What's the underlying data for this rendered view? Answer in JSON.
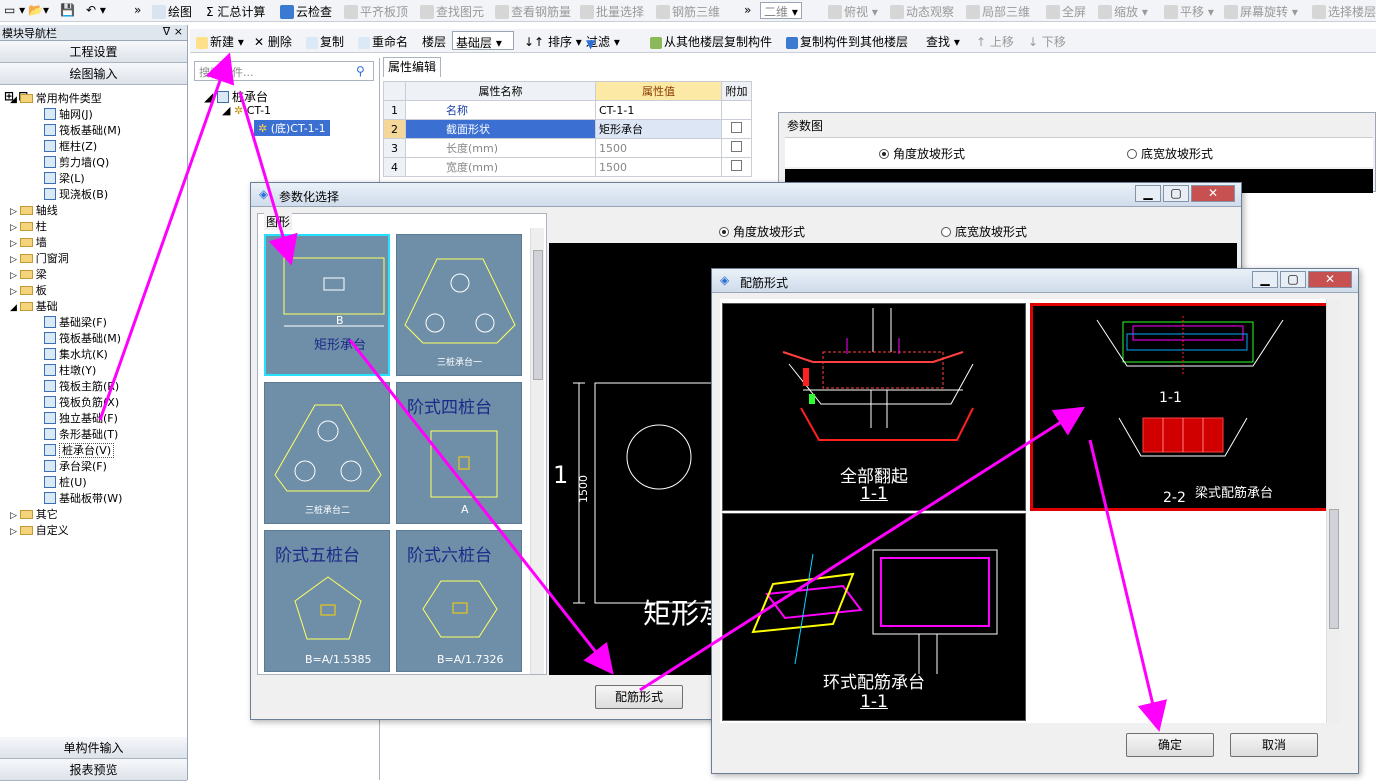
{
  "toolbar": {
    "draw": "绘图",
    "sum": "汇总计算",
    "cloud": "云检查",
    "flat": "平齐板顶",
    "find_elem": "查找图元",
    "view_rebar": "查看钢筋量",
    "batch_select": "批量选择",
    "rebar3d": "钢筋三维",
    "dim": "二维",
    "top_view": "俯视",
    "orbit": "动态观察",
    "local3d": "局部三维",
    "fullscreen": "全屏",
    "zoom": "缩放",
    "pan": "平移",
    "rotate": "屏幕旋转",
    "select_floor": "选择楼层"
  },
  "toolbar2": {
    "new": "新建",
    "delete": "删除",
    "copy": "复制",
    "rename": "重命名",
    "floor_label": "楼层",
    "floor_value": "基础层",
    "sort": "排序",
    "filter": "过滤",
    "copy_from": "从其他楼层复制构件",
    "copy_to": "复制构件到其他楼层",
    "find": "查找",
    "up": "上移",
    "down": "下移"
  },
  "nav": {
    "title": "模块导航栏",
    "pin": "꜈ ×",
    "project_settings": "工程设置",
    "draw_input": "绘图输入",
    "single_input": "单构件输入",
    "report_preview": "报表预览",
    "tree": [
      {
        "label": "常用构件类型",
        "type": "folder",
        "level": 0,
        "open": true
      },
      {
        "label": "轴网(J)",
        "type": "item",
        "level": 1
      },
      {
        "label": "筏板基础(M)",
        "type": "item",
        "level": 1
      },
      {
        "label": "框柱(Z)",
        "type": "item",
        "level": 1
      },
      {
        "label": "剪力墙(Q)",
        "type": "item",
        "level": 1
      },
      {
        "label": "梁(L)",
        "type": "item",
        "level": 1
      },
      {
        "label": "现浇板(B)",
        "type": "item",
        "level": 1
      },
      {
        "label": "轴线",
        "type": "folder",
        "level": 0
      },
      {
        "label": "柱",
        "type": "folder",
        "level": 0
      },
      {
        "label": "墙",
        "type": "folder",
        "level": 0
      },
      {
        "label": "门窗洞",
        "type": "folder",
        "level": 0
      },
      {
        "label": "梁",
        "type": "folder",
        "level": 0
      },
      {
        "label": "板",
        "type": "folder",
        "level": 0
      },
      {
        "label": "基础",
        "type": "folder",
        "level": 0,
        "open": true
      },
      {
        "label": "基础梁(F)",
        "type": "item",
        "level": 1
      },
      {
        "label": "筏板基础(M)",
        "type": "item",
        "level": 1
      },
      {
        "label": "集水坑(K)",
        "type": "item",
        "level": 1
      },
      {
        "label": "柱墩(Y)",
        "type": "item",
        "level": 1
      },
      {
        "label": "筏板主筋(R)",
        "type": "item",
        "level": 1
      },
      {
        "label": "筏板负筋(X)",
        "type": "item",
        "level": 1
      },
      {
        "label": "独立基础(F)",
        "type": "item",
        "level": 1
      },
      {
        "label": "条形基础(T)",
        "type": "item",
        "level": 1
      },
      {
        "label": "桩承台(V)",
        "type": "item",
        "level": 1,
        "selected": true
      },
      {
        "label": "承台梁(F)",
        "type": "item",
        "level": 1
      },
      {
        "label": "桩(U)",
        "type": "item",
        "level": 1
      },
      {
        "label": "基础板带(W)",
        "type": "item",
        "level": 1
      },
      {
        "label": "其它",
        "type": "folder",
        "level": 0
      },
      {
        "label": "自定义",
        "type": "folder",
        "level": 0
      }
    ]
  },
  "component_tree": {
    "search_placeholder": "搜索构件...",
    "root": "桩承台",
    "child": "CT-1",
    "leaf": "(底)CT-1-1"
  },
  "props": {
    "tab": "属性编辑",
    "col_name": "属性名称",
    "col_value": "属性值",
    "col_extra": "附加",
    "rows": [
      {
        "n": "1",
        "name": "名称",
        "value": "CT-1-1"
      },
      {
        "n": "2",
        "name": "截面形状",
        "value": "矩形承台"
      },
      {
        "n": "3",
        "name": "长度(mm)",
        "value": "1500"
      },
      {
        "n": "4",
        "name": "宽度(mm)",
        "value": "1500"
      }
    ]
  },
  "param_fig": {
    "title": "参数图",
    "opt1": "角度放坡形式",
    "opt2": "底宽放坡形式"
  },
  "param_select": {
    "title": "参数化选择",
    "group": "图形",
    "opt1": "角度放坡形式",
    "opt2": "底宽放坡形式",
    "shapes": [
      {
        "label": "矩形承台",
        "dim": "B"
      },
      {
        "label": "三桩承台一"
      },
      {
        "label": "三桩承台二"
      },
      {
        "label": "阶式四桩台",
        "dim": "A"
      },
      {
        "label": "阶式五桩台",
        "formula": "B=A/1.5385"
      },
      {
        "label": "阶式六桩台",
        "formula": "B=A/1.7326"
      }
    ],
    "preview_label": "矩形承",
    "preview_dim": "1500",
    "preview_one": "1",
    "btn": "配筋形式"
  },
  "rebar_form": {
    "title": "配筋形式",
    "opt_all": "全部翻起",
    "sec_all": "1-1",
    "opt_beam": "梁式配筋承台",
    "sec_beam1": "1-1",
    "sec_beam2": "2-2",
    "opt_ring": "环式配筋承台",
    "sec_ring": "1-1",
    "ok": "确定",
    "cancel": "取消"
  },
  "colors": {
    "accent": "#ff00ff",
    "selected_row": "#3b6fd1",
    "selected_border": "#e00000",
    "thumb_bg": "#6f8fa8"
  }
}
